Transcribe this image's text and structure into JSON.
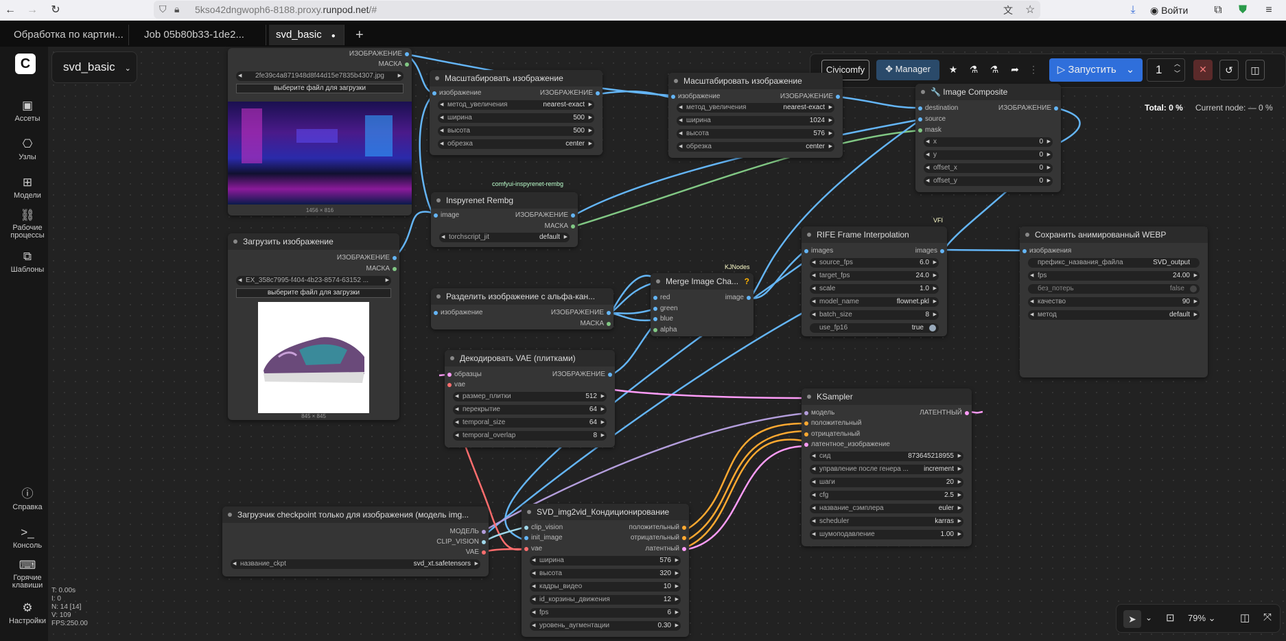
{
  "browser": {
    "url_dim": "5kso42dngwoph6-8188.proxy.",
    "url_main": "runpod.net",
    "url_rest": "/#",
    "signin_label": "Войти"
  },
  "tabs": [
    {
      "label": "Обработка по картин..."
    },
    {
      "label": "Job 05b80b33-1de2..."
    },
    {
      "label": "svd_basic"
    }
  ],
  "workflow_title": "svd_basic",
  "sidebar": {
    "items": [
      {
        "label": "Ассеты"
      },
      {
        "label": "Узлы"
      },
      {
        "label": "Модели"
      },
      {
        "label": "Рабочие процессы"
      },
      {
        "label": "Шаблоны"
      },
      {
        "label": "Справка"
      },
      {
        "label": "Консоль"
      },
      {
        "label": "Горячие клавиши"
      },
      {
        "label": "Настройки"
      }
    ]
  },
  "toolbar": {
    "civicomfy": "Civicomfy",
    "manager": "Manager",
    "run": "Запустить",
    "queue_count": "1",
    "total": "Total: 0 %",
    "current": "Current node: — 0 %"
  },
  "stats": {
    "t": "T: 0.00s",
    "i": "I: 0",
    "n": "N: 14 [14]",
    "v": "V: 109",
    "fps": "FPS:250.00"
  },
  "zoom": "79%",
  "nodes": {
    "load1": {
      "out_image": "ИЗОБРАЖЕНИЕ",
      "out_mask": "МАСКА",
      "file": "2fe39c4a871948d8f44d15e7835b4307.jpg",
      "upload": "выберите файл для загрузки",
      "size": "1456 × 816"
    },
    "scale1": {
      "title": "Масштабировать изображение",
      "in": "изображение",
      "out": "ИЗОБРАЖЕНИЕ",
      "w": [
        [
          "метод_увеличения",
          "nearest-exact"
        ],
        [
          "ширина",
          "500"
        ],
        [
          "высота",
          "500"
        ],
        [
          "обрезка",
          "center"
        ]
      ]
    },
    "scale2": {
      "title": "Масштабировать изображение",
      "in": "изображение",
      "out": "ИЗОБРАЖЕНИЕ",
      "w": [
        [
          "метод_увеличения",
          "nearest-exact"
        ],
        [
          "ширина",
          "1024"
        ],
        [
          "высота",
          "576"
        ],
        [
          "обрезка",
          "center"
        ]
      ]
    },
    "composite": {
      "title": "🔧 Image Composite",
      "ins": [
        "destination",
        "source",
        "mask"
      ],
      "out": "ИЗОБРАЖЕНИЕ",
      "w": [
        [
          "x",
          "0"
        ],
        [
          "y",
          "0"
        ],
        [
          "offset_x",
          "0"
        ],
        [
          "offset_y",
          "0"
        ]
      ]
    },
    "rembg": {
      "badge": "comfyui-inspyrenet-rembg",
      "title": "Inspyrenet Rembg",
      "in": "image",
      "out1": "ИЗОБРАЖЕНИЕ",
      "out2": "МАСКА",
      "w": [
        [
          "torchscript_jit",
          "default"
        ]
      ]
    },
    "load2": {
      "title": "Загрузить изображение",
      "out_image": "ИЗОБРАЖЕНИЕ",
      "out_mask": "МАСКА",
      "file": "EX_358c7995-f404-4b23-8574-63152 ...",
      "upload": "выберите файл для загрузки",
      "size": "845 × 845"
    },
    "split": {
      "title": "Разделить изображение с альфа-кан...",
      "in": "изображение",
      "out1": "ИЗОБРАЖЕНИЕ",
      "out2": "МАСКА"
    },
    "merge": {
      "badge": "KJNodes",
      "title": "Merge Image Cha...",
      "ins": [
        "red",
        "green",
        "blue",
        "alpha"
      ],
      "out": "image"
    },
    "rife": {
      "badge": "VFI",
      "title": "RIFE Frame Interpolation",
      "in": "images",
      "out": "images",
      "w": [
        [
          "source_fps",
          "6.0"
        ],
        [
          "target_fps",
          "24.0"
        ],
        [
          "scale",
          "1.0"
        ],
        [
          "model_name",
          "flownet.pkl"
        ],
        [
          "batch_size",
          "8"
        ],
        [
          "use_fp16",
          "true"
        ]
      ]
    },
    "save": {
      "title": "Сохранить анимированный WEBP",
      "in": "изображения",
      "w": [
        [
          "префикс_названия_файла",
          "SVD_output"
        ],
        [
          "fps",
          "24.00"
        ],
        [
          "без_потерь",
          "false"
        ],
        [
          "качество",
          "90"
        ],
        [
          "метод",
          "default"
        ]
      ]
    },
    "decode": {
      "title": "Декодировать VAE (плитками)",
      "ins": [
        "образцы",
        "vae"
      ],
      "out": "ИЗОБРАЖЕНИЕ",
      "w": [
        [
          "размер_плитки",
          "512"
        ],
        [
          "перекрытие",
          "64"
        ],
        [
          "temporal_size",
          "64"
        ],
        [
          "temporal_overlap",
          "8"
        ]
      ]
    },
    "ksampler": {
      "title": "KSampler",
      "ins": [
        "модель",
        "положительный",
        "отрицательный",
        "латентное_изображение"
      ],
      "out": "ЛАТЕНТНЫЙ",
      "w": [
        [
          "сид",
          "873645218955"
        ],
        [
          "управление после генера ...",
          "increment"
        ],
        [
          "шаги",
          "20"
        ],
        [
          "cfg",
          "2.5"
        ],
        [
          "название_сэмплера",
          "euler"
        ],
        [
          "scheduler",
          "karras"
        ],
        [
          "шумоподавление",
          "1.00"
        ]
      ]
    },
    "ckpt": {
      "title": "Загрузчик checkpoint только для изображения (модель img...",
      "outs": [
        "МОДЕЛЬ",
        "CLIP_VISION",
        "VAE"
      ],
      "w": [
        [
          "название_ckpt",
          "svd_xt.safetensors"
        ]
      ]
    },
    "svd": {
      "title": "SVD_img2vid_Кондиционирование",
      "ins": [
        "clip_vision",
        "init_image",
        "vae"
      ],
      "outs": [
        "положительный",
        "отрицательный",
        "латентный"
      ],
      "w": [
        [
          "ширина",
          "576"
        ],
        [
          "высота",
          "320"
        ],
        [
          "кадры_видео",
          "10"
        ],
        [
          "id_корзины_движения",
          "12"
        ],
        [
          "fps",
          "6"
        ],
        [
          "уровень_аугментации",
          "0.30"
        ]
      ]
    }
  }
}
